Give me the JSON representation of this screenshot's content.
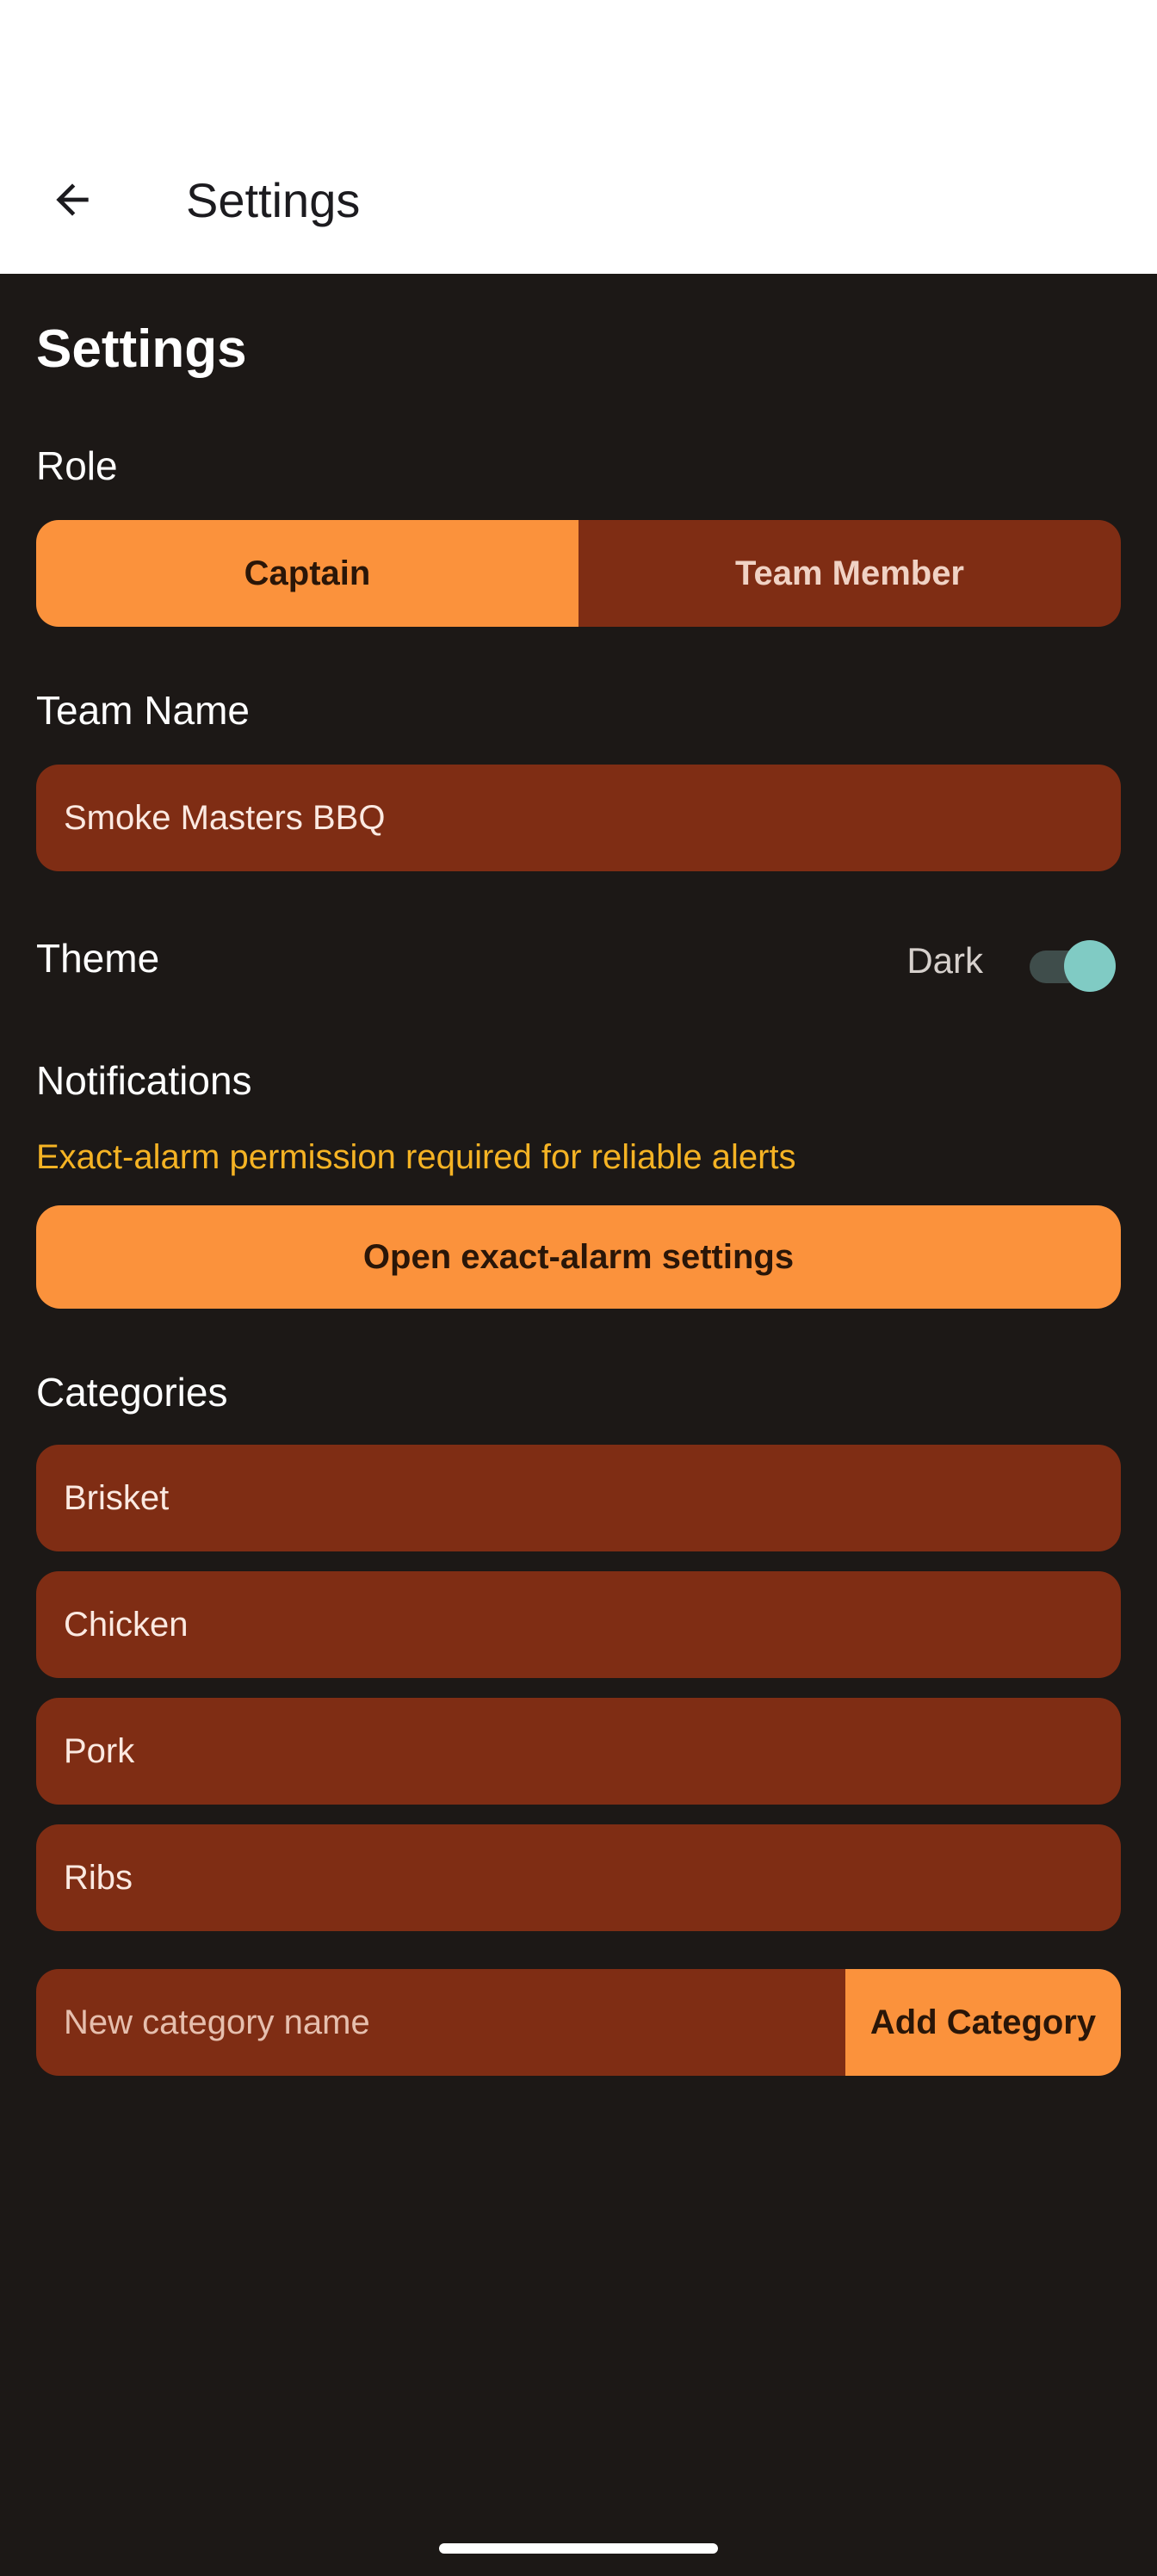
{
  "appbar": {
    "title": "Settings",
    "back_icon": "arrow-left-icon"
  },
  "page": {
    "heading": "Settings"
  },
  "role": {
    "label": "Role",
    "options": [
      "Captain",
      "Team Member"
    ],
    "selected": "Captain"
  },
  "team": {
    "label": "Team Name",
    "value": "Smoke Masters BBQ"
  },
  "theme": {
    "label": "Theme",
    "value": "Dark",
    "enabled": true
  },
  "notifications": {
    "label": "Notifications",
    "warning": "Exact-alarm permission required for reliable alerts",
    "button_label": "Open exact-alarm settings"
  },
  "categories": {
    "label": "Categories",
    "items": [
      "Brisket",
      "Chicken",
      "Pork",
      "Ribs"
    ],
    "new_placeholder": "New category name",
    "add_label": "Add Category"
  },
  "colors": {
    "background": "#1c1816",
    "accent": "#fb923c",
    "field": "#7f2d14",
    "warning": "#f5b324",
    "toggle_thumb": "#80cbc4"
  }
}
